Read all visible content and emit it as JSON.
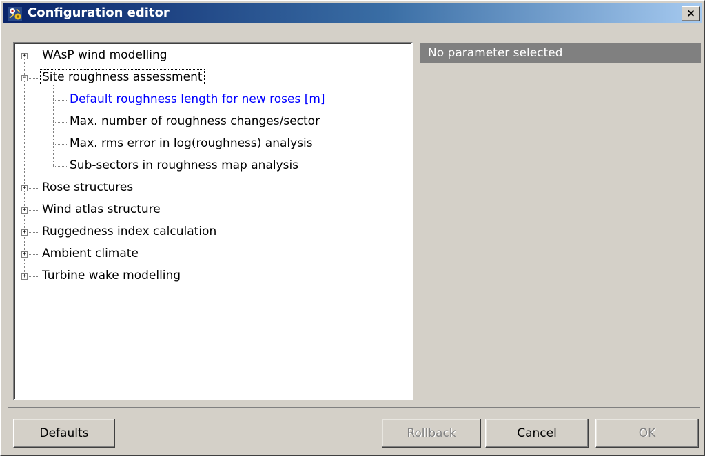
{
  "window": {
    "title": "Configuration editor",
    "close_glyph": "×",
    "icon": "app-icon"
  },
  "tree": {
    "nodes": [
      {
        "label": "WAsP wind modelling",
        "expander": "+",
        "expanded": false,
        "level": 0
      },
      {
        "label": "Site roughness assessment",
        "expander": "−",
        "expanded": true,
        "selected": true,
        "level": 0
      },
      {
        "label": "Default roughness length for new roses [m]",
        "level": 1,
        "hot": true
      },
      {
        "label": "Max. number of roughness changes/sector",
        "level": 1
      },
      {
        "label": "Max. rms error in log(roughness) analysis",
        "level": 1
      },
      {
        "label": "Sub-sectors in roughness map analysis",
        "level": 1
      },
      {
        "label": "Rose structures",
        "expander": "+",
        "expanded": false,
        "level": 0
      },
      {
        "label": "Wind atlas structure",
        "expander": "+",
        "expanded": false,
        "level": 0
      },
      {
        "label": "Ruggedness index calculation",
        "expander": "+",
        "expanded": false,
        "level": 0
      },
      {
        "label": "Ambient climate",
        "expander": "+",
        "expanded": false,
        "level": 0
      },
      {
        "label": "Turbine wake modelling",
        "expander": "+",
        "expanded": false,
        "level": 0
      }
    ]
  },
  "parameter_panel": {
    "header": "No parameter selected"
  },
  "buttons": {
    "defaults": "Defaults",
    "rollback": "Rollback",
    "cancel": "Cancel",
    "ok": "OK"
  },
  "colors": {
    "title_gradient_start": "#0a246a",
    "title_gradient_end": "#a6caf0",
    "face": "#d4d0c8",
    "hot_link": "#0000ff",
    "panel_header": "#808080"
  }
}
